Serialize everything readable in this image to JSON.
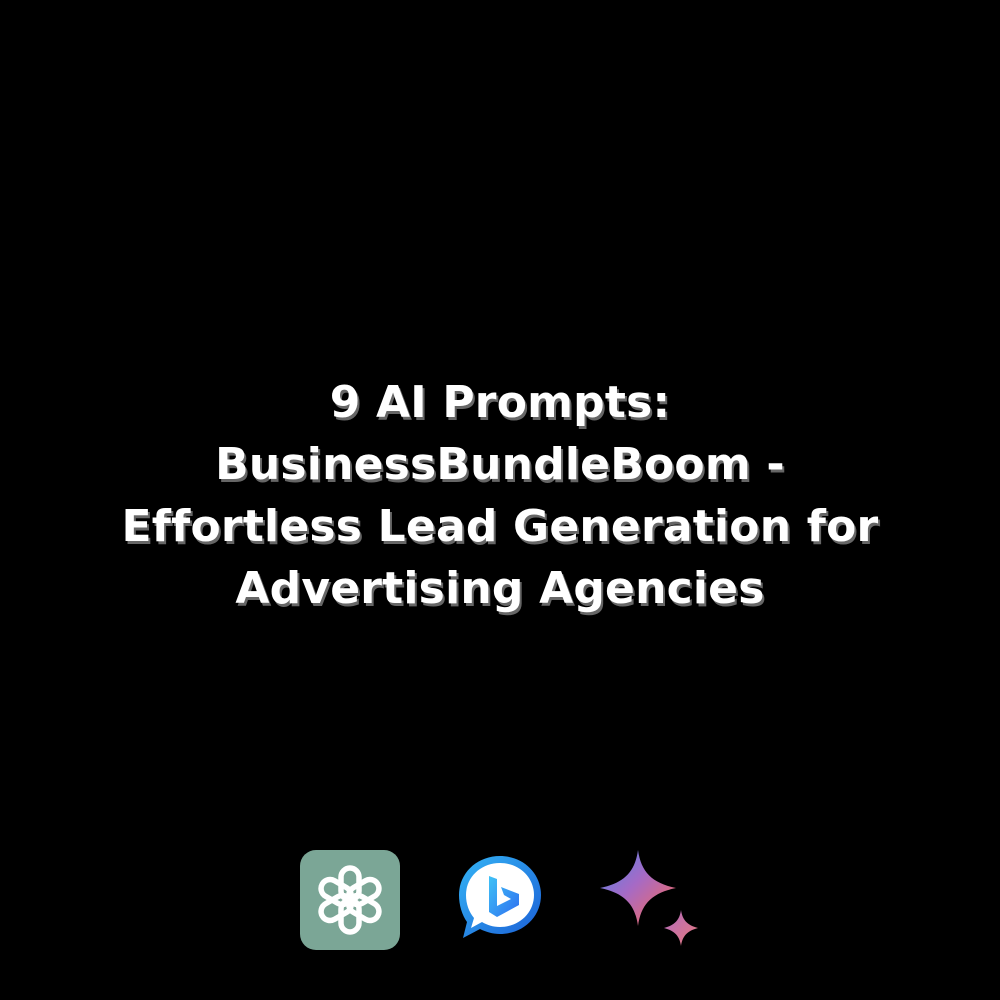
{
  "title": {
    "lines": [
      "9 AI Prompts:",
      "BusinessBundleBoom -",
      "Effortless Lead Generation for",
      "Advertising Agencies"
    ]
  },
  "logos": [
    {
      "icon": "openai-chatgpt-icon",
      "color": "#7ba696"
    },
    {
      "icon": "bing-chat-icon",
      "color": "#2a8ef0"
    },
    {
      "icon": "gemini-sparkle-icon",
      "color": "#c974a6"
    }
  ],
  "colors": {
    "background": "#000000",
    "text": "#ffffff"
  }
}
